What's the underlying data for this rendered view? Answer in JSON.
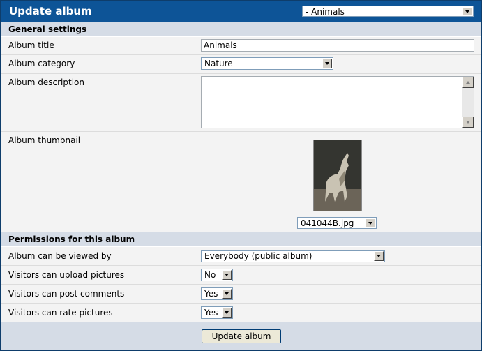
{
  "header": {
    "title": "Update album",
    "album_select": "- Animals"
  },
  "general": {
    "heading": "General settings",
    "album_title_label": "Album title",
    "album_title_value": "Animals",
    "album_category_label": "Album category",
    "album_category_value": "Nature",
    "album_description_label": "Album description",
    "album_description_value": "",
    "album_thumbnail_label": "Album thumbnail",
    "thumbnail_file": "041044B.jpg"
  },
  "permissions": {
    "heading": "Permissions for this album",
    "viewed_by_label": "Album can be viewed by",
    "viewed_by_value": "Everybody (public album)",
    "upload_label": "Visitors can upload pictures",
    "upload_value": "No",
    "comments_label": "Visitors can post comments",
    "comments_value": "Yes",
    "rate_label": "Visitors can rate pictures",
    "rate_value": "Yes"
  },
  "footer": {
    "submit_label": "Update album"
  }
}
